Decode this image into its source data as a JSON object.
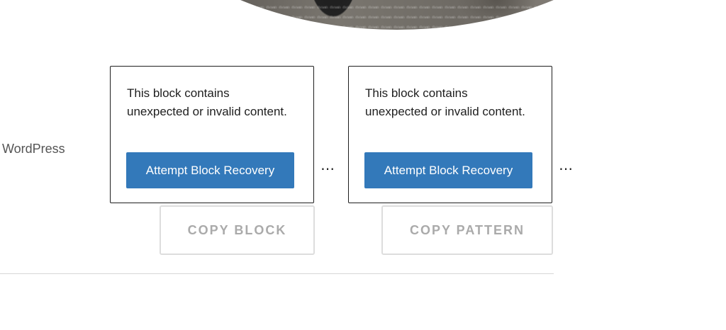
{
  "side_text": "r WordPress",
  "blocks": [
    {
      "warning": "This block contains unexpected or invalid content.",
      "recovery_label": "Attempt Block Recovery",
      "more_label": "⋯",
      "copy_label": "COPY BLOCK"
    },
    {
      "warning": "This block contains unexpected or invalid content.",
      "recovery_label": "Attempt Block Recovery",
      "more_label": "⋯",
      "copy_label": "COPY PATTERN"
    }
  ],
  "colors": {
    "recovery_button": "#3379ba",
    "copy_button_text": "#aaaaaa",
    "border": "#1e1e1e"
  }
}
